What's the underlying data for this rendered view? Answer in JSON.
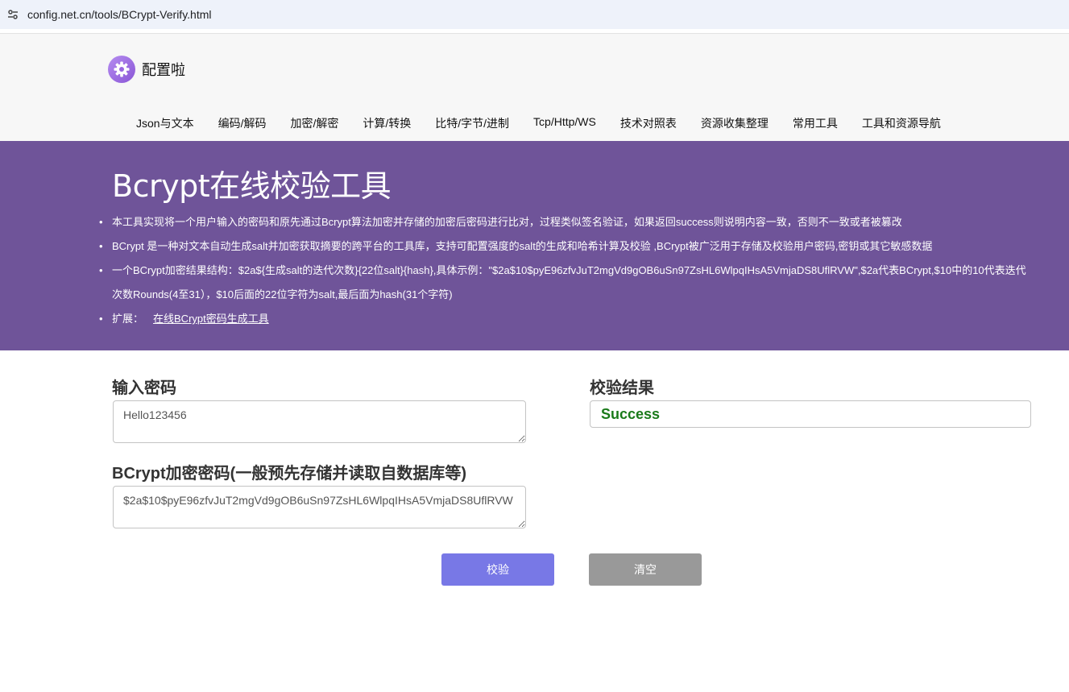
{
  "browser": {
    "url": "config.net.cn/tools/BCrypt-Verify.html",
    "site_info_icon": "tune-icon"
  },
  "header": {
    "logo_text": "配置啦",
    "logo_icon": "gear-icon",
    "nav": [
      "Json与文本",
      "编码/解码",
      "加密/解密",
      "计算/转换",
      "比特/字节/进制",
      "Tcp/Http/WS",
      "技术对照表",
      "资源收集整理",
      "常用工具",
      "工具和资源导航"
    ]
  },
  "banner": {
    "title": "Bcrypt在线校验工具",
    "bullets": [
      "本工具实现将一个用户输入的密码和原先通过Bcrypt算法加密并存储的加密后密码进行比对，过程类似签名验证，如果返回success则说明内容一致，否则不一致或者被篡改",
      "BCrypt 是一种对文本自动生成salt并加密获取摘要的跨平台的工具库，支持可配置强度的salt的生成和哈希计算及校验 ,BCrypt被广泛用于存储及校验用户密码,密钥或其它敏感数据",
      "一个BCrypt加密结果结构：$2a${生成salt的迭代次数}{22位salt}{hash},具体示例：\"$2a$10$pyE96zfvJuT2mgVd9gOB6uSn97ZsHL6WlpqIHsA5VmjaDS8UflRVW\",$2a代表BCrypt,$10中的10代表迭代次数Rounds(4至31），$10后面的22位字符为salt,最后面为hash(31个字符)"
    ],
    "extend_label": "扩展：",
    "extend_link": "在线BCrypt密码生成工具"
  },
  "form": {
    "password_label": "输入密码",
    "password_value": "Hello123456",
    "hash_label": "BCrypt加密密码(一般预先存储并读取自数据库等)",
    "hash_value": "$2a$10$pyE96zfvJuT2mgVd9gOB6uSn97ZsHL6WlpqIHsA5VmjaDS8UflRVW",
    "result_label": "校验结果",
    "result_value": "Success",
    "verify_button": "校验",
    "clear_button": "清空"
  },
  "colors": {
    "banner": "#6f5499",
    "verify_button": "#7878e6",
    "clear_button": "#999999",
    "success_text": "#1a7a1a"
  }
}
